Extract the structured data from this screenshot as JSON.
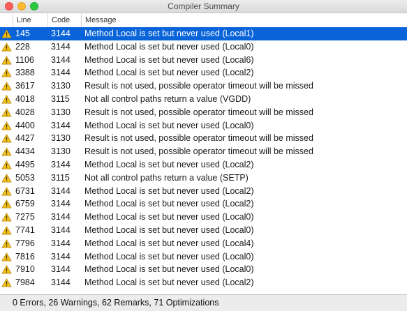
{
  "window": {
    "title": "Compiler Summary"
  },
  "columns": {
    "line": "Line",
    "code": "Code",
    "message": "Message"
  },
  "icons": {
    "row_icon": "warning-icon"
  },
  "colors": {
    "selection": "#0a64d9",
    "warning_fill": "#f5c518"
  },
  "rows": [
    {
      "line": "145",
      "code": "3144",
      "message": "Method Local is set but never used (Local1)",
      "selected": true
    },
    {
      "line": "228",
      "code": "3144",
      "message": "Method Local is set but never used (Local0)"
    },
    {
      "line": "1106",
      "code": "3144",
      "message": "Method Local is set but never used (Local6)"
    },
    {
      "line": "3388",
      "code": "3144",
      "message": "Method Local is set but never used (Local2)"
    },
    {
      "line": "3617",
      "code": "3130",
      "message": "Result is not used, possible operator timeout will be missed"
    },
    {
      "line": "4018",
      "code": "3115",
      "message": "Not all control paths return a value (VGDD)"
    },
    {
      "line": "4028",
      "code": "3130",
      "message": "Result is not used, possible operator timeout will be missed"
    },
    {
      "line": "4400",
      "code": "3144",
      "message": "Method Local is set but never used (Local0)"
    },
    {
      "line": "4427",
      "code": "3130",
      "message": "Result is not used, possible operator timeout will be missed"
    },
    {
      "line": "4434",
      "code": "3130",
      "message": "Result is not used, possible operator timeout will be missed"
    },
    {
      "line": "4495",
      "code": "3144",
      "message": "Method Local is set but never used (Local2)"
    },
    {
      "line": "5053",
      "code": "3115",
      "message": "Not all control paths return a value (SETP)"
    },
    {
      "line": "6731",
      "code": "3144",
      "message": "Method Local is set but never used (Local2)"
    },
    {
      "line": "6759",
      "code": "3144",
      "message": "Method Local is set but never used (Local2)"
    },
    {
      "line": "7275",
      "code": "3144",
      "message": "Method Local is set but never used (Local0)"
    },
    {
      "line": "7741",
      "code": "3144",
      "message": "Method Local is set but never used (Local0)"
    },
    {
      "line": "7796",
      "code": "3144",
      "message": "Method Local is set but never used (Local4)"
    },
    {
      "line": "7816",
      "code": "3144",
      "message": "Method Local is set but never used (Local0)"
    },
    {
      "line": "7910",
      "code": "3144",
      "message": "Method Local is set but never used (Local0)"
    },
    {
      "line": "7984",
      "code": "3144",
      "message": "Method Local is set but never used (Local2)"
    }
  ],
  "status": {
    "summary": "0 Errors, 26 Warnings, 62 Remarks, 71 Optimizations"
  }
}
